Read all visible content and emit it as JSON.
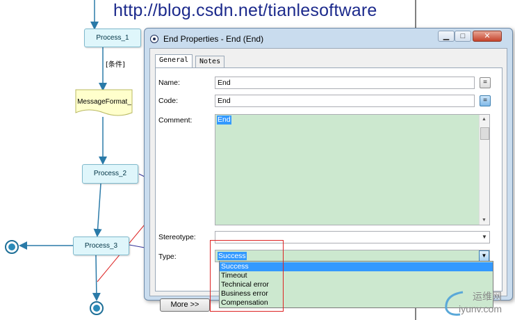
{
  "watermark": {
    "url": "http://blog.csdn.net/tianlesoftware"
  },
  "diagram": {
    "nodes": [
      {
        "id": "process1",
        "label": "Process_1"
      },
      {
        "id": "message",
        "label": "MessageFormat_"
      },
      {
        "id": "process2",
        "label": "Process_2"
      },
      {
        "id": "process3",
        "label": "Process_3"
      }
    ],
    "condition_label": "[条件]"
  },
  "dialog": {
    "title": "End Properties - End (End)",
    "tabs": [
      {
        "label": "General"
      },
      {
        "label": "Notes"
      }
    ],
    "name_label": "Name:",
    "name_value": "End",
    "code_label": "Code:",
    "code_value": "End",
    "comment_label": "Comment:",
    "comment_value": "End",
    "stereotype_label": "Stereotype:",
    "stereotype_value": "",
    "type_label": "Type:",
    "type_value": "Success",
    "type_options": [
      "Success",
      "Timeout",
      "Technical error",
      "Business error",
      "Compensation"
    ],
    "more_button": "More >>",
    "eq_symbol": "="
  },
  "logo": {
    "brand": "运维网",
    "domain": "iyunv.com"
  },
  "colors": {
    "field_green": "#cce8cf",
    "highlight": "#3399ff",
    "annotation_red": "#dd2222"
  }
}
